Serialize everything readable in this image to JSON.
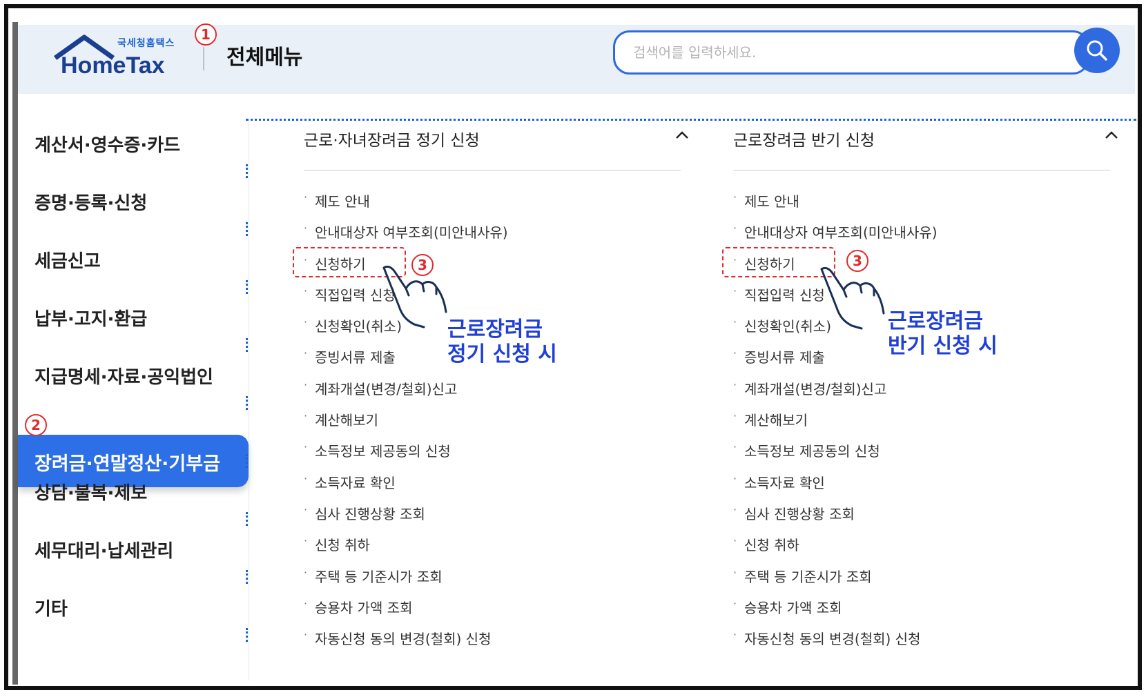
{
  "header": {
    "logo_small": "국세청홈택스",
    "logo_text": "HomeTax",
    "menu_title": "전체메뉴",
    "search_placeholder": "검색어를 입력하세요."
  },
  "sidebar": {
    "items": [
      {
        "label": "계산서·영수증·카드"
      },
      {
        "label": "증명·등록·신청"
      },
      {
        "label": "세금신고"
      },
      {
        "label": "납부·고지·환급"
      },
      {
        "label": "지급명세·자료·공익법인"
      },
      {
        "label": "장려금·연말정산·기부금",
        "active": true
      },
      {
        "label": "상담·불복·제보"
      },
      {
        "label": "세무대리·납세관리"
      },
      {
        "label": "기타"
      }
    ]
  },
  "columns": [
    {
      "title": "근로·자녀장려금 정기 신청",
      "items": [
        "제도 안내",
        "안내대상자 여부조회(미안내사유)",
        "신청하기",
        "직접입력 신청",
        "신청확인(취소)",
        "증빙서류 제출",
        "계좌개설(변경/철회)신고",
        "계산해보기",
        "소득정보 제공동의 신청",
        "소득자료 확인",
        "심사 진행상황 조회",
        "신청 취하",
        "주택 등 기준시가 조회",
        "승용차 가액 조회",
        "자동신청 동의 변경(철회) 신청"
      ],
      "annotation": [
        "근로장려금",
        "정기 신청 시"
      ]
    },
    {
      "title": "근로장려금 반기 신청",
      "items": [
        "제도 안내",
        "안내대상자 여부조회(미안내사유)",
        "신청하기",
        "직접입력 신청",
        "신청확인(취소)",
        "증빙서류 제출",
        "계좌개설(변경/철회)신고",
        "계산해보기",
        "소득정보 제공동의 신청",
        "소득자료 확인",
        "심사 진행상황 조회",
        "신청 취하",
        "주택 등 기준시가 조회",
        "승용차 가액 조회",
        "자동신청 동의 변경(철회) 신청"
      ],
      "annotation": [
        "근로장려금",
        "반기 신청 시"
      ]
    }
  ],
  "markers": {
    "one": "1",
    "two": "2",
    "three": "3"
  },
  "colors": {
    "accent": "#2c6fe6",
    "annotation_red": "#e12b2b",
    "annotation_blue": "#1f3fd6"
  }
}
